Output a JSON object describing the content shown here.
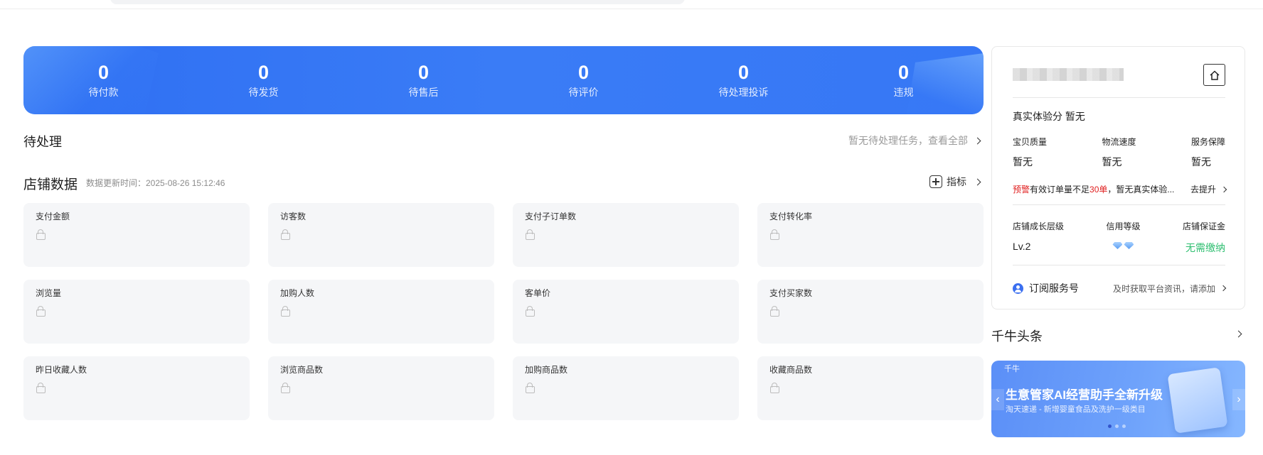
{
  "stats": [
    {
      "value": "0",
      "label": "待付款"
    },
    {
      "value": "0",
      "label": "待发货"
    },
    {
      "value": "0",
      "label": "待售后"
    },
    {
      "value": "0",
      "label": "待评价"
    },
    {
      "value": "0",
      "label": "待处理投诉"
    },
    {
      "value": "0",
      "label": "违规"
    }
  ],
  "pending": {
    "title": "待处理",
    "link": "暂无待处理任务，查看全部"
  },
  "store_data": {
    "title": "店铺数据",
    "update_time": "数据更新时间：2025-08-26 15:12:46",
    "metrics_link": "指标",
    "cards": [
      "支付金额",
      "访客数",
      "支付子订单数",
      "支付转化率",
      "浏览量",
      "加购人数",
      "客单价",
      "支付买家数",
      "昨日收藏人数",
      "浏览商品数",
      "加购商品数",
      "收藏商品数"
    ]
  },
  "shop_panel": {
    "experience_label": "真实体验分",
    "experience_value": "暂无",
    "sub_scores": [
      {
        "label": "宝贝质量",
        "value": "暂无"
      },
      {
        "label": "物流速度",
        "value": "暂无"
      },
      {
        "label": "服务保障",
        "value": "暂无"
      }
    ],
    "warning": {
      "tag": "预警",
      "text1": "有效订单量不足",
      "count": "30单",
      "text2": "，暂无真实体验...",
      "action": "去提升"
    },
    "growth_label": "店铺成长层级",
    "growth_value": "Lv.2",
    "credit_label": "信用等级",
    "deposit_label": "店铺保证金",
    "deposit_value": "无需缴纳",
    "subscribe_label": "订阅服务号",
    "subscribe_hint": "及时获取平台资讯，请添加"
  },
  "news": {
    "title": "千牛头条",
    "banner_brand": "千牛",
    "banner_headline": "生意管家AI经营助手全新升级",
    "banner_subline": "淘天速递 - 新增婴童食品及洗护一级类目"
  },
  "colors": {
    "banner_blue": "#3a7cf6",
    "warn_red": "#e02020",
    "ok_green": "#2fbf71"
  }
}
